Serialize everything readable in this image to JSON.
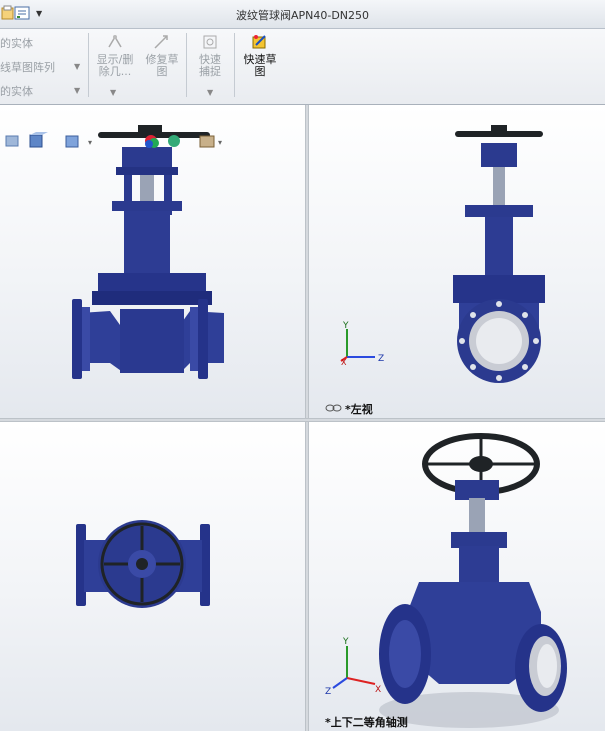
{
  "window": {
    "title": "波纹管球阀APN40-DN250"
  },
  "ribbon": {
    "left_items": [
      "的实体",
      "线草图阵列",
      "的实体"
    ],
    "display_delete": "显示/删除几...",
    "repair_sketch": "修复草图",
    "quick_snap": "快速捕捉",
    "quick_sketch": "快速草图"
  },
  "viewports": {
    "top_right": {
      "label": "*左视"
    },
    "bottom_right": {
      "label": "*上下二等角轴测"
    }
  },
  "triad": {
    "x": "X",
    "y": "Y",
    "z": "Z"
  },
  "colors": {
    "valve_blue": "#2b3a8f",
    "handwheel": "#1f2326",
    "background": "#eef1f5"
  }
}
